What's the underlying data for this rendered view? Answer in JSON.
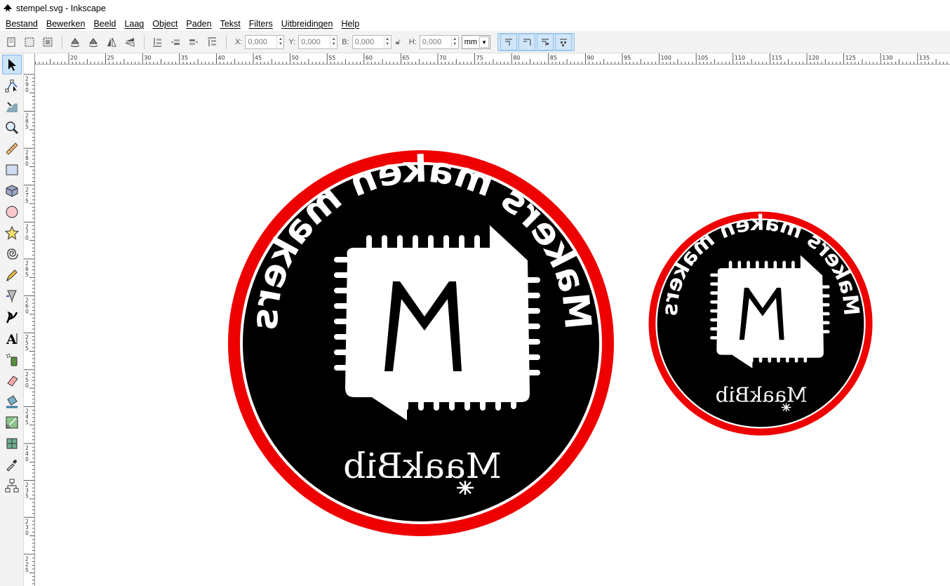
{
  "window": {
    "title": "stempel.svg - Inkscape"
  },
  "menu": [
    "Bestand",
    "Bewerken",
    "Beeld",
    "Laag",
    "Object",
    "Paden",
    "Tekst",
    "Filters",
    "Uitbreidingen",
    "Help"
  ],
  "toolbar": {
    "x_label": "X:",
    "x_value": "0,000",
    "y_label": "Y:",
    "y_value": "0,000",
    "w_label": "B:",
    "w_value": "0,000",
    "h_label": "H:",
    "h_value": "0,000",
    "unit": "mm"
  },
  "rulers": {
    "horizontal_labels": [
      "20",
      "25",
      "30",
      "35",
      "40",
      "45",
      "50",
      "55",
      "60",
      "65",
      "70",
      "75",
      "80",
      "85",
      "90",
      "95",
      "100",
      "105",
      "110",
      "115",
      "120",
      "125",
      "130",
      "135"
    ],
    "vertical_labels": [
      "290",
      "285",
      "280",
      "275",
      "270",
      "265",
      "260",
      "255",
      "250",
      "245",
      "240",
      "235",
      "230",
      "225"
    ]
  },
  "tools": [
    "selector-tool",
    "node-tool",
    "tweak-tool",
    "zoom-tool",
    "measure-tool",
    "rectangle-tool",
    "box3d-tool",
    "ellipse-tool",
    "star-tool",
    "spiral-tool",
    "pencil-tool",
    "pen-tool",
    "calligraphy-tool",
    "text-tool",
    "spray-tool",
    "eraser-tool",
    "paint-bucket-tool",
    "gradient-tool",
    "mesh-tool",
    "dropper-tool",
    "connector-tool"
  ],
  "stamps": {
    "arc_text": "Makers maken makers",
    "brand_text": "MaakBib",
    "ring_color": "#ee0000",
    "fill_color": "#000000",
    "text_color": "#ffffff"
  }
}
